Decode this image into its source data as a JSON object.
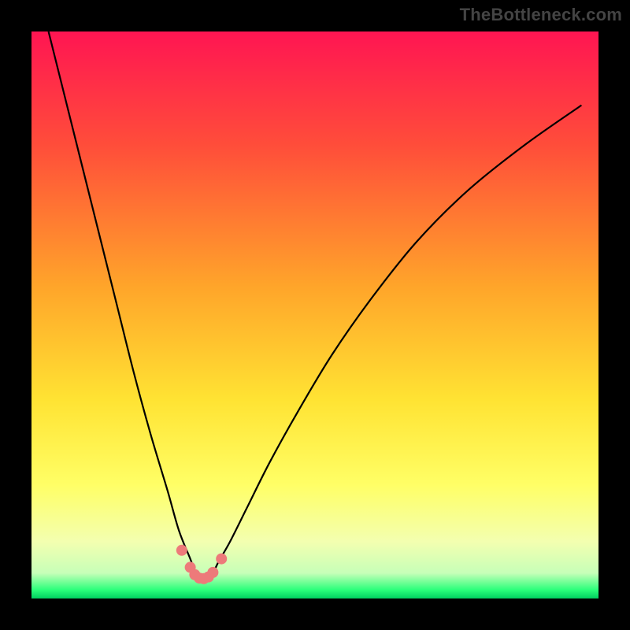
{
  "watermark": "TheBottleneck.com",
  "colors": {
    "black": "#000000",
    "curve": "#000000",
    "marker": "#ed7a7a",
    "gradient_stops": [
      {
        "offset": 0.0,
        "color": "#ff1552"
      },
      {
        "offset": 0.2,
        "color": "#ff4d3a"
      },
      {
        "offset": 0.45,
        "color": "#ffa52a"
      },
      {
        "offset": 0.65,
        "color": "#ffe333"
      },
      {
        "offset": 0.8,
        "color": "#ffff66"
      },
      {
        "offset": 0.9,
        "color": "#f3ffb0"
      },
      {
        "offset": 0.955,
        "color": "#c7ffb8"
      },
      {
        "offset": 0.985,
        "color": "#2aff7a"
      },
      {
        "offset": 1.0,
        "color": "#00d060"
      }
    ]
  },
  "chart_data": {
    "type": "line",
    "title": "",
    "xlabel": "",
    "ylabel": "",
    "xlim": [
      0,
      100
    ],
    "ylim": [
      0,
      100
    ],
    "note": "x and y are percentages of the plot area (0–100). y=0 is bottom (no bottleneck), y=100 is top. The curve dips to a minimum around x≈30 and rises steeply on either side. Pink markers cluster near the minimum.",
    "series": [
      {
        "name": "bottleneck-curve",
        "x": [
          3,
          6,
          9,
          12,
          15,
          18,
          21,
          24,
          26,
          28,
          29,
          30,
          31,
          32,
          33,
          35,
          38,
          42,
          47,
          53,
          60,
          68,
          77,
          87,
          97
        ],
        "y": [
          100,
          88,
          76,
          64,
          52,
          40,
          29,
          19,
          12,
          7,
          4.5,
          3.5,
          3.5,
          4.5,
          6.5,
          10,
          16,
          24,
          33,
          43,
          53,
          63,
          72,
          80,
          87
        ]
      }
    ],
    "markers": {
      "name": "highlight-points",
      "x": [
        26.5,
        28.0,
        28.8,
        29.6,
        30.4,
        31.2,
        32.0,
        33.5
      ],
      "y": [
        8.5,
        5.5,
        4.2,
        3.6,
        3.5,
        3.8,
        4.6,
        7.0
      ]
    }
  }
}
